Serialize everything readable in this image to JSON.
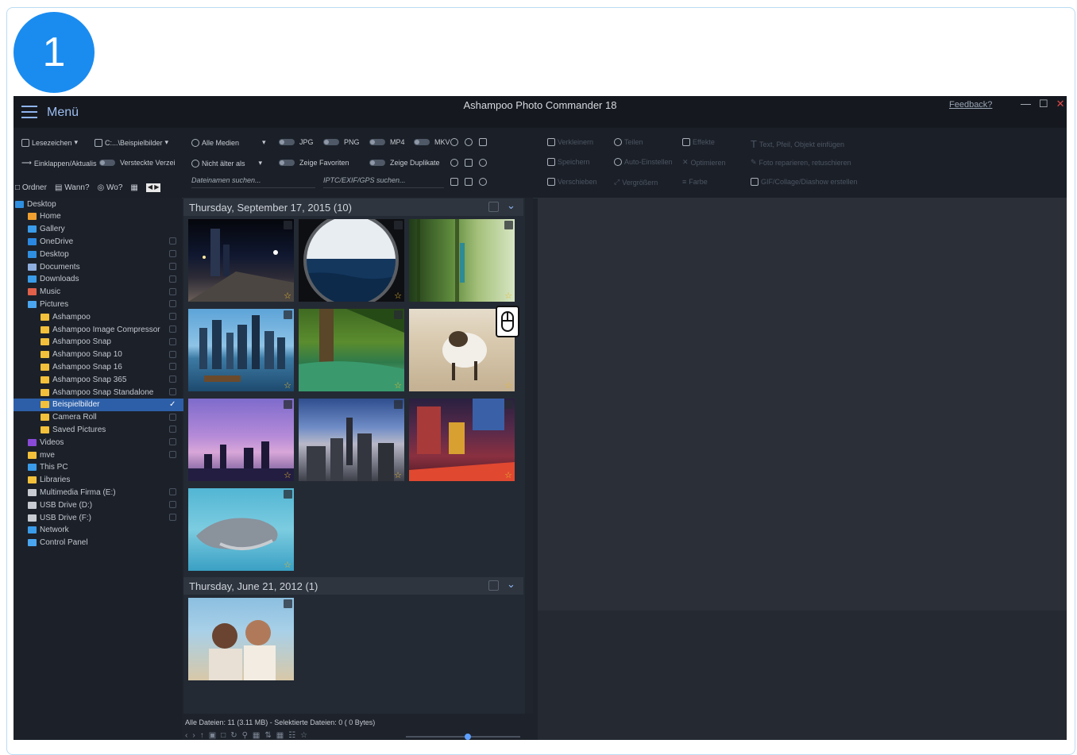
{
  "step": {
    "number": "1"
  },
  "colors": {
    "accent": "#1a8cf0",
    "selection": "#2d5fa8",
    "star": "#e7b92e",
    "close": "#e04848"
  },
  "titlebar": {
    "menu_label": "Menü",
    "app_title": "Ashampoo Photo Commander 18",
    "feedback": "Feedback?",
    "minimize": "—",
    "maximize": "☐",
    "close": "✕"
  },
  "toolbar": {
    "bookmarks": "Lesezeichen",
    "path": "C:...\\Beispielbilder",
    "collapse": "Einklappen/Aktualis",
    "hidden": "Versteckte Verzei",
    "all_media": "Alle Medien",
    "filter_jpg": "JPG",
    "filter_png": "PNG",
    "filter_mp4": "MP4",
    "filter_mkv": "MKV",
    "not_older": "Nicht älter als",
    "show_favorites": "Zeige Favoriten",
    "show_duplicates": "Zeige Duplikate",
    "filename_search_placeholder": "Dateinamen suchen...",
    "exif_search_placeholder": "IPTC/EXIF/GPS suchen...",
    "dim_actions": [
      "Verkleinern",
      "Teilen",
      "Effekte",
      "Text, Pfeil, Objekt einfügen",
      "Speichern",
      "Auto-Einstellen",
      "Optimieren",
      "Foto reparieren, retuschieren",
      "Verschieben",
      "Vergrößern",
      "Farbe",
      "GIF/Collage/Diashow erstellen"
    ]
  },
  "tree_tabs": {
    "folder": "Ordner",
    "when": "Wann?",
    "where": "Wo?"
  },
  "tree": [
    {
      "label": "Desktop",
      "level": 0,
      "icon": "desktop-icon",
      "color": "#2f8fe0"
    },
    {
      "label": "Home",
      "level": 1,
      "icon": "home-icon",
      "color": "#f0a030"
    },
    {
      "label": "Gallery",
      "level": 1,
      "icon": "gallery-icon",
      "color": "#3a9be8"
    },
    {
      "label": "OneDrive",
      "level": 1,
      "icon": "cloud-icon",
      "color": "#2b88e0"
    },
    {
      "label": "Desktop",
      "level": 1,
      "icon": "desktop-icon",
      "color": "#2f8fe0"
    },
    {
      "label": "Documents",
      "level": 1,
      "icon": "document-icon",
      "color": "#8faee0"
    },
    {
      "label": "Downloads",
      "level": 1,
      "icon": "download-icon",
      "color": "#3a9be8"
    },
    {
      "label": "Music",
      "level": 1,
      "icon": "music-icon",
      "color": "#e0604a"
    },
    {
      "label": "Pictures",
      "level": 1,
      "icon": "pictures-icon",
      "color": "#4aa6ef"
    },
    {
      "label": "Ashampoo",
      "level": 2,
      "icon": "folder-icon",
      "color": "#f2c03a"
    },
    {
      "label": "Ashampoo Image Compressor",
      "level": 2,
      "icon": "folder-icon",
      "color": "#f2c03a"
    },
    {
      "label": "Ashampoo Snap",
      "level": 2,
      "icon": "folder-icon",
      "color": "#f2c03a"
    },
    {
      "label": "Ashampoo Snap 10",
      "level": 2,
      "icon": "folder-icon",
      "color": "#f2c03a"
    },
    {
      "label": "Ashampoo Snap 16",
      "level": 2,
      "icon": "folder-icon",
      "color": "#f2c03a"
    },
    {
      "label": "Ashampoo Snap 365",
      "level": 2,
      "icon": "folder-icon",
      "color": "#f2c03a"
    },
    {
      "label": "Ashampoo Snap Standalone",
      "level": 2,
      "icon": "folder-icon",
      "color": "#f2c03a"
    },
    {
      "label": "Beispielbilder",
      "level": 2,
      "icon": "folder-icon",
      "color": "#f2c03a",
      "selected": true
    },
    {
      "label": "Camera Roll",
      "level": 2,
      "icon": "folder-icon",
      "color": "#f2c03a"
    },
    {
      "label": "Saved Pictures",
      "level": 2,
      "icon": "folder-icon",
      "color": "#f2c03a"
    },
    {
      "label": "Videos",
      "level": 1,
      "icon": "video-icon",
      "color": "#8a4ad8"
    },
    {
      "label": "mve",
      "level": 1,
      "icon": "folder-icon",
      "color": "#f2c03a"
    },
    {
      "label": "This PC",
      "level": 1,
      "icon": "computer-icon",
      "color": "#3a9be8"
    },
    {
      "label": "Libraries",
      "level": 1,
      "icon": "folder-icon",
      "color": "#f2c03a"
    },
    {
      "label": "Multimedia Firma (E:)",
      "level": 1,
      "icon": "drive-icon",
      "color": "#c8ccd2"
    },
    {
      "label": "USB Drive (D:)",
      "level": 1,
      "icon": "drive-icon",
      "color": "#c8ccd2"
    },
    {
      "label": "USB Drive (F:)",
      "level": 1,
      "icon": "drive-icon",
      "color": "#c8ccd2"
    },
    {
      "label": "Network",
      "level": 1,
      "icon": "network-icon",
      "color": "#3a9be8"
    },
    {
      "label": "Control Panel",
      "level": 1,
      "icon": "control-panel-icon",
      "color": "#4aa6ef"
    }
  ],
  "groups": [
    {
      "title": "Thursday, September 17, 2015  (10)"
    },
    {
      "title": "Thursday, June 21, 2012  (1)"
    }
  ],
  "status": {
    "text": "Alle Dateien: 11 (3.11 MB) - Selektierte Dateien: 0 (   0 Bytes)"
  }
}
